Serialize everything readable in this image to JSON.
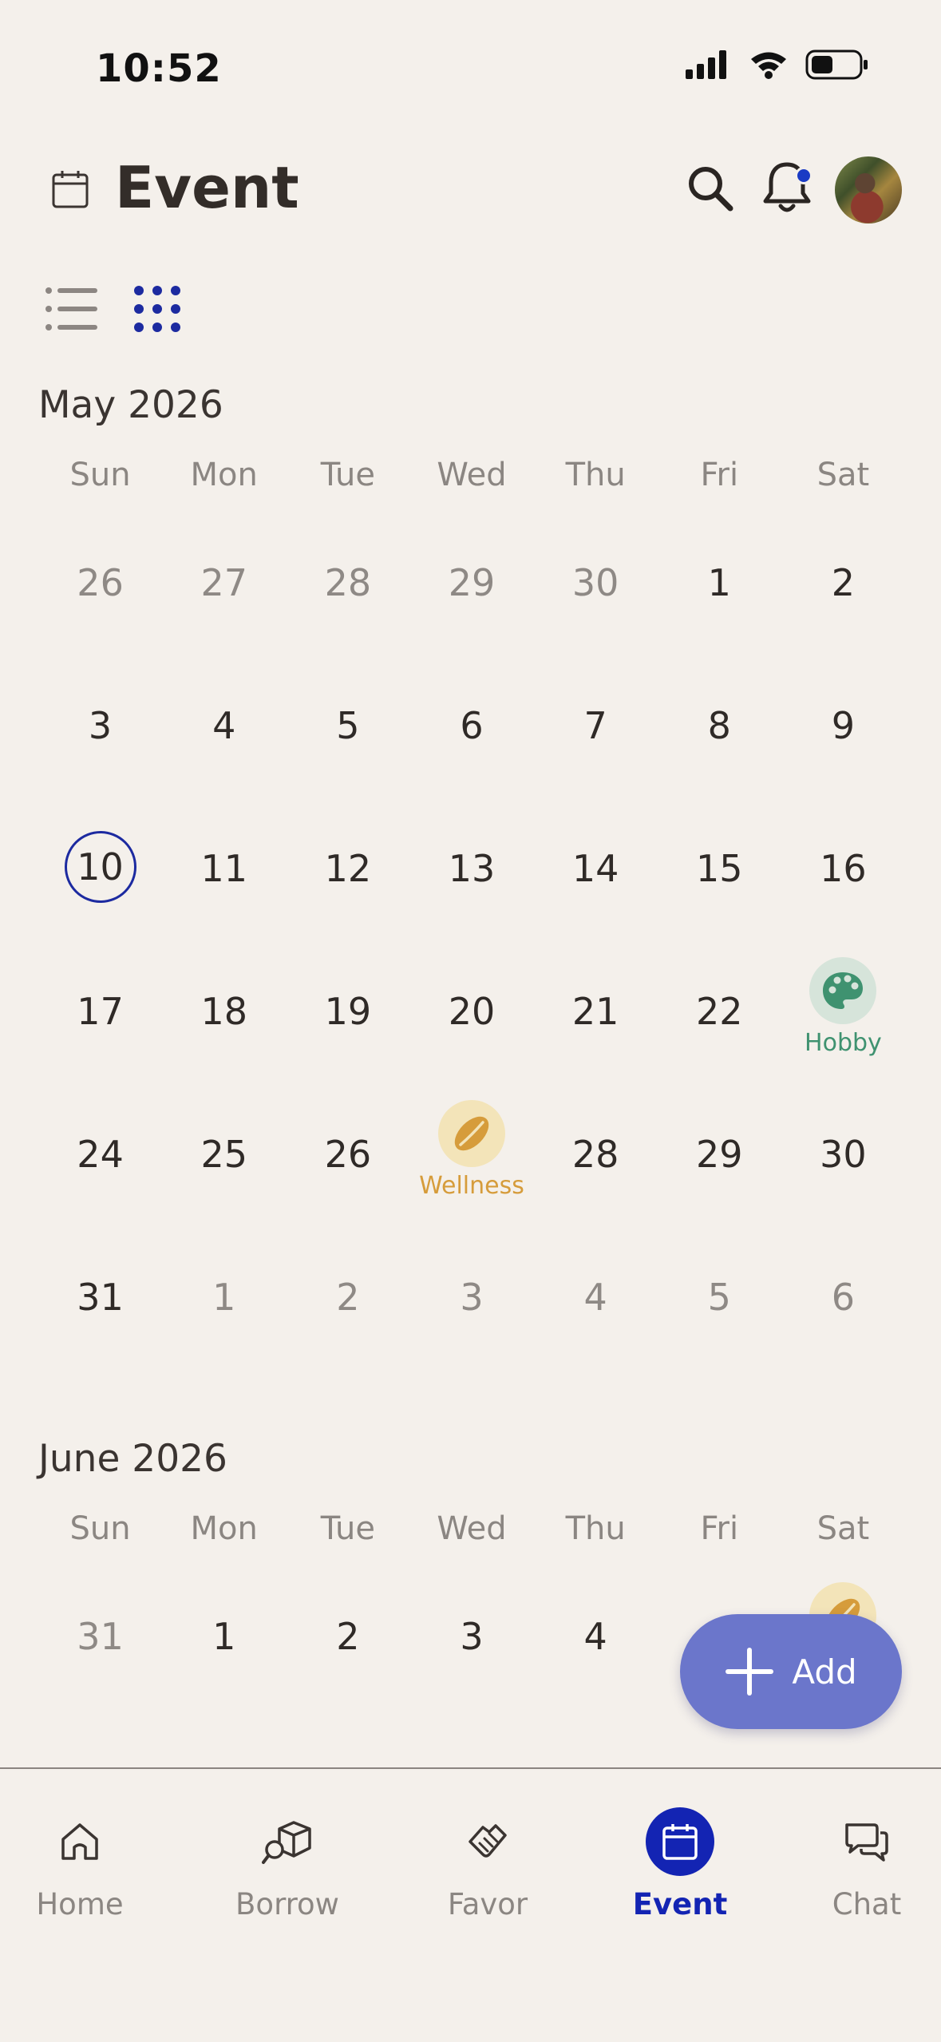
{
  "status_bar": {
    "time": "10:52"
  },
  "header": {
    "title": "Event"
  },
  "calendar": {
    "weekdays": [
      "Sun",
      "Mon",
      "Tue",
      "Wed",
      "Thu",
      "Fri",
      "Sat"
    ],
    "months": [
      {
        "label": "May 2026",
        "weeks": [
          [
            "26",
            "27",
            "28",
            "29",
            "30",
            "1",
            "2"
          ],
          [
            "3",
            "4",
            "5",
            "6",
            "7",
            "8",
            "9"
          ],
          [
            "10",
            "11",
            "12",
            "13",
            "14",
            "15",
            "16"
          ],
          [
            "17",
            "18",
            "19",
            "20",
            "21",
            "22",
            ""
          ],
          [
            "24",
            "25",
            "26",
            "",
            "28",
            "29",
            "30"
          ],
          [
            "31",
            "1",
            "2",
            "3",
            "4",
            "5",
            "6"
          ]
        ]
      },
      {
        "label": "June 2026",
        "weeks": [
          [
            "31",
            "1",
            "2",
            "3",
            "4",
            "",
            ""
          ]
        ]
      }
    ],
    "events": {
      "hobby": {
        "label": "Hobby",
        "icon": "palette-icon",
        "color": "#3f9270"
      },
      "wellness": {
        "label": "Wellness",
        "icon": "leaf-icon",
        "color": "#d69c3b"
      }
    }
  },
  "fab": {
    "label": "Add"
  },
  "nav": {
    "home": "Home",
    "borrow": "Borrow",
    "favor": "Favor",
    "event": "Event",
    "chat": "Chat"
  },
  "colors": {
    "accent": "#1324b3",
    "fab": "#6b76cb",
    "background": "#f4f0eb"
  }
}
